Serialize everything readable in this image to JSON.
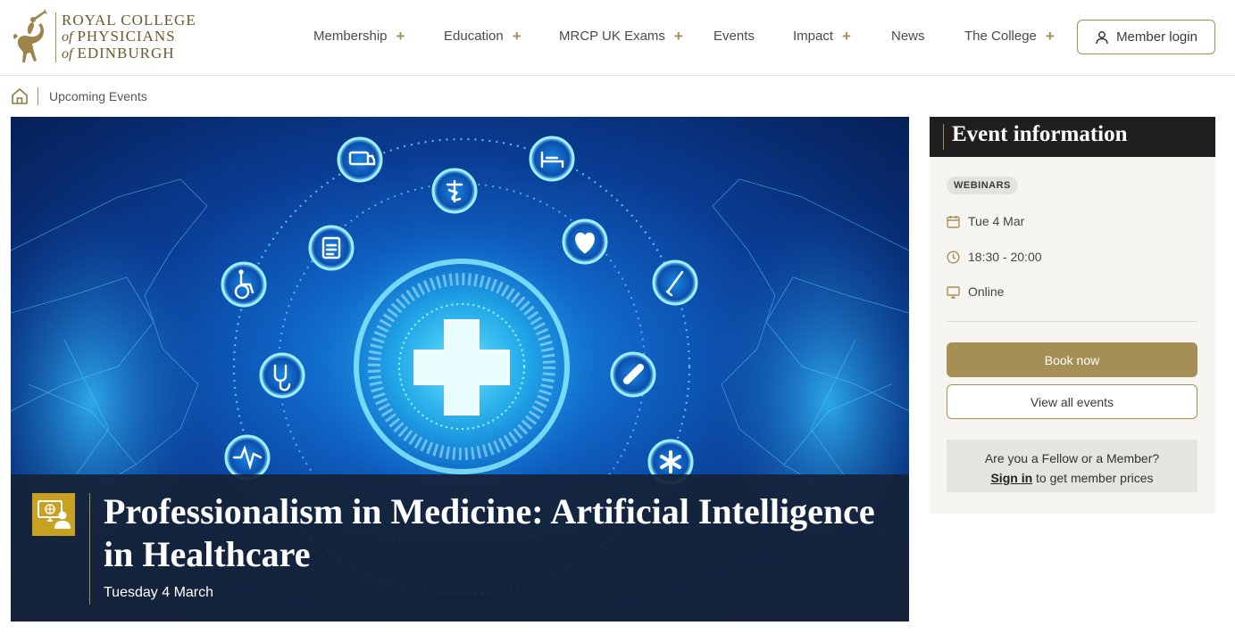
{
  "colors": {
    "gold": "#a58f55",
    "dark": "#1f1f1f",
    "caption_bg": "#162238",
    "caption_icon_bg": "#c8a122"
  },
  "logo": {
    "line1": "ROYAL COLLEGE",
    "line2_prefix": "of",
    "line2": "PHYSICIANS",
    "line3_prefix": "of",
    "line3": "EDINBURGH",
    "icon": "horse-trumpeter-icon"
  },
  "nav": {
    "items": [
      {
        "label": "Membership",
        "expandable": true
      },
      {
        "label": "Education",
        "expandable": true
      },
      {
        "label": "MRCP UK Exams",
        "expandable": true
      },
      {
        "label": "Events",
        "expandable": false
      },
      {
        "label": "Impact",
        "expandable": true
      },
      {
        "label": "News",
        "expandable": false
      },
      {
        "label": "The College",
        "expandable": true
      }
    ],
    "plus_glyph": "+",
    "login_label": "Member login"
  },
  "breadcrumb": {
    "home_icon": "home-icon",
    "current": "Upcoming Events"
  },
  "hero": {
    "title": "Professionalism in Medicine: Artificial Intelligence in Healthcare",
    "date": "Tuesday 4 March",
    "icon": "webinar-icon"
  },
  "event_info": {
    "heading": "Event information",
    "category": "WEBINARS",
    "date": "Tue 4 Mar",
    "time": "18:30 - 20:00",
    "location": "Online",
    "book_label": "Book now",
    "view_all_label": "View all events",
    "member_question": "Are you a Fellow or a Member?",
    "sign_in_label": "Sign in",
    "sign_in_suffix": "to get member prices"
  }
}
